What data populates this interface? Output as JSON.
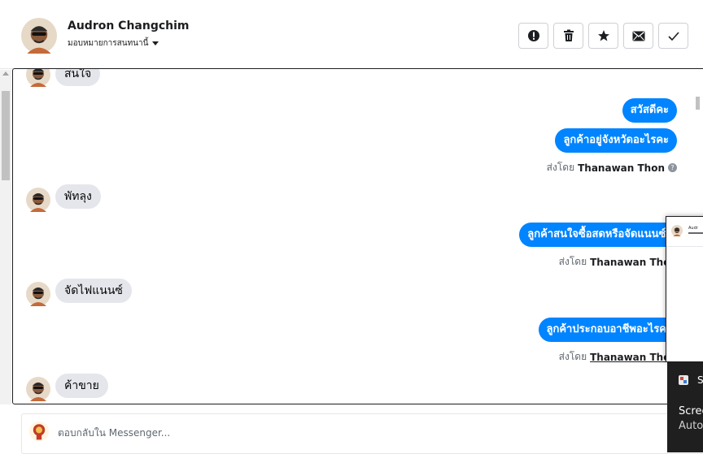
{
  "header": {
    "name": "Audron Changchim",
    "assign_label": "มอบหมายการสนทนานี้",
    "actions": [
      {
        "name": "report-icon"
      },
      {
        "name": "trash-icon"
      },
      {
        "name": "star-icon"
      },
      {
        "name": "mail-icon"
      },
      {
        "name": "check-icon"
      }
    ]
  },
  "messages": {
    "m0": {
      "text": "สนใจ"
    },
    "m1": {
      "text": "สวัสดีคะ"
    },
    "m2": {
      "text": "ลูกค้าอยู่จังหวัดอะไรคะ"
    },
    "m2_sent": {
      "prefix": "ส่งโดย",
      "name": "Thanawan Thon"
    },
    "m3": {
      "text": "พัทลุง"
    },
    "m4": {
      "text": "ลูกค้าสนใจซื้อสดหรือจัดแนนซ์คะ"
    },
    "m4_sent": {
      "prefix": "ส่งโดย",
      "name": "Thanawan Thon"
    },
    "m5": {
      "text": "จัดไฟแนนซ์"
    },
    "m6": {
      "text": "ลูกค้าประกอบอาชีพอะไรคะ"
    },
    "m6_sent": {
      "prefix": "ส่งโดย",
      "name": "Thanawan Thon"
    },
    "m7": {
      "text": "ค้าขาย"
    }
  },
  "composer": {
    "placeholder": "ตอบกลับใน Messenger..."
  },
  "preview": {
    "name": "Audr"
  },
  "toast": {
    "app_initial": "S",
    "title": "Scree",
    "subtitle": "Autor"
  },
  "colors": {
    "accent": "#0084ff",
    "bubble_in": "#e4e6eb",
    "border": "#1c1e21"
  }
}
